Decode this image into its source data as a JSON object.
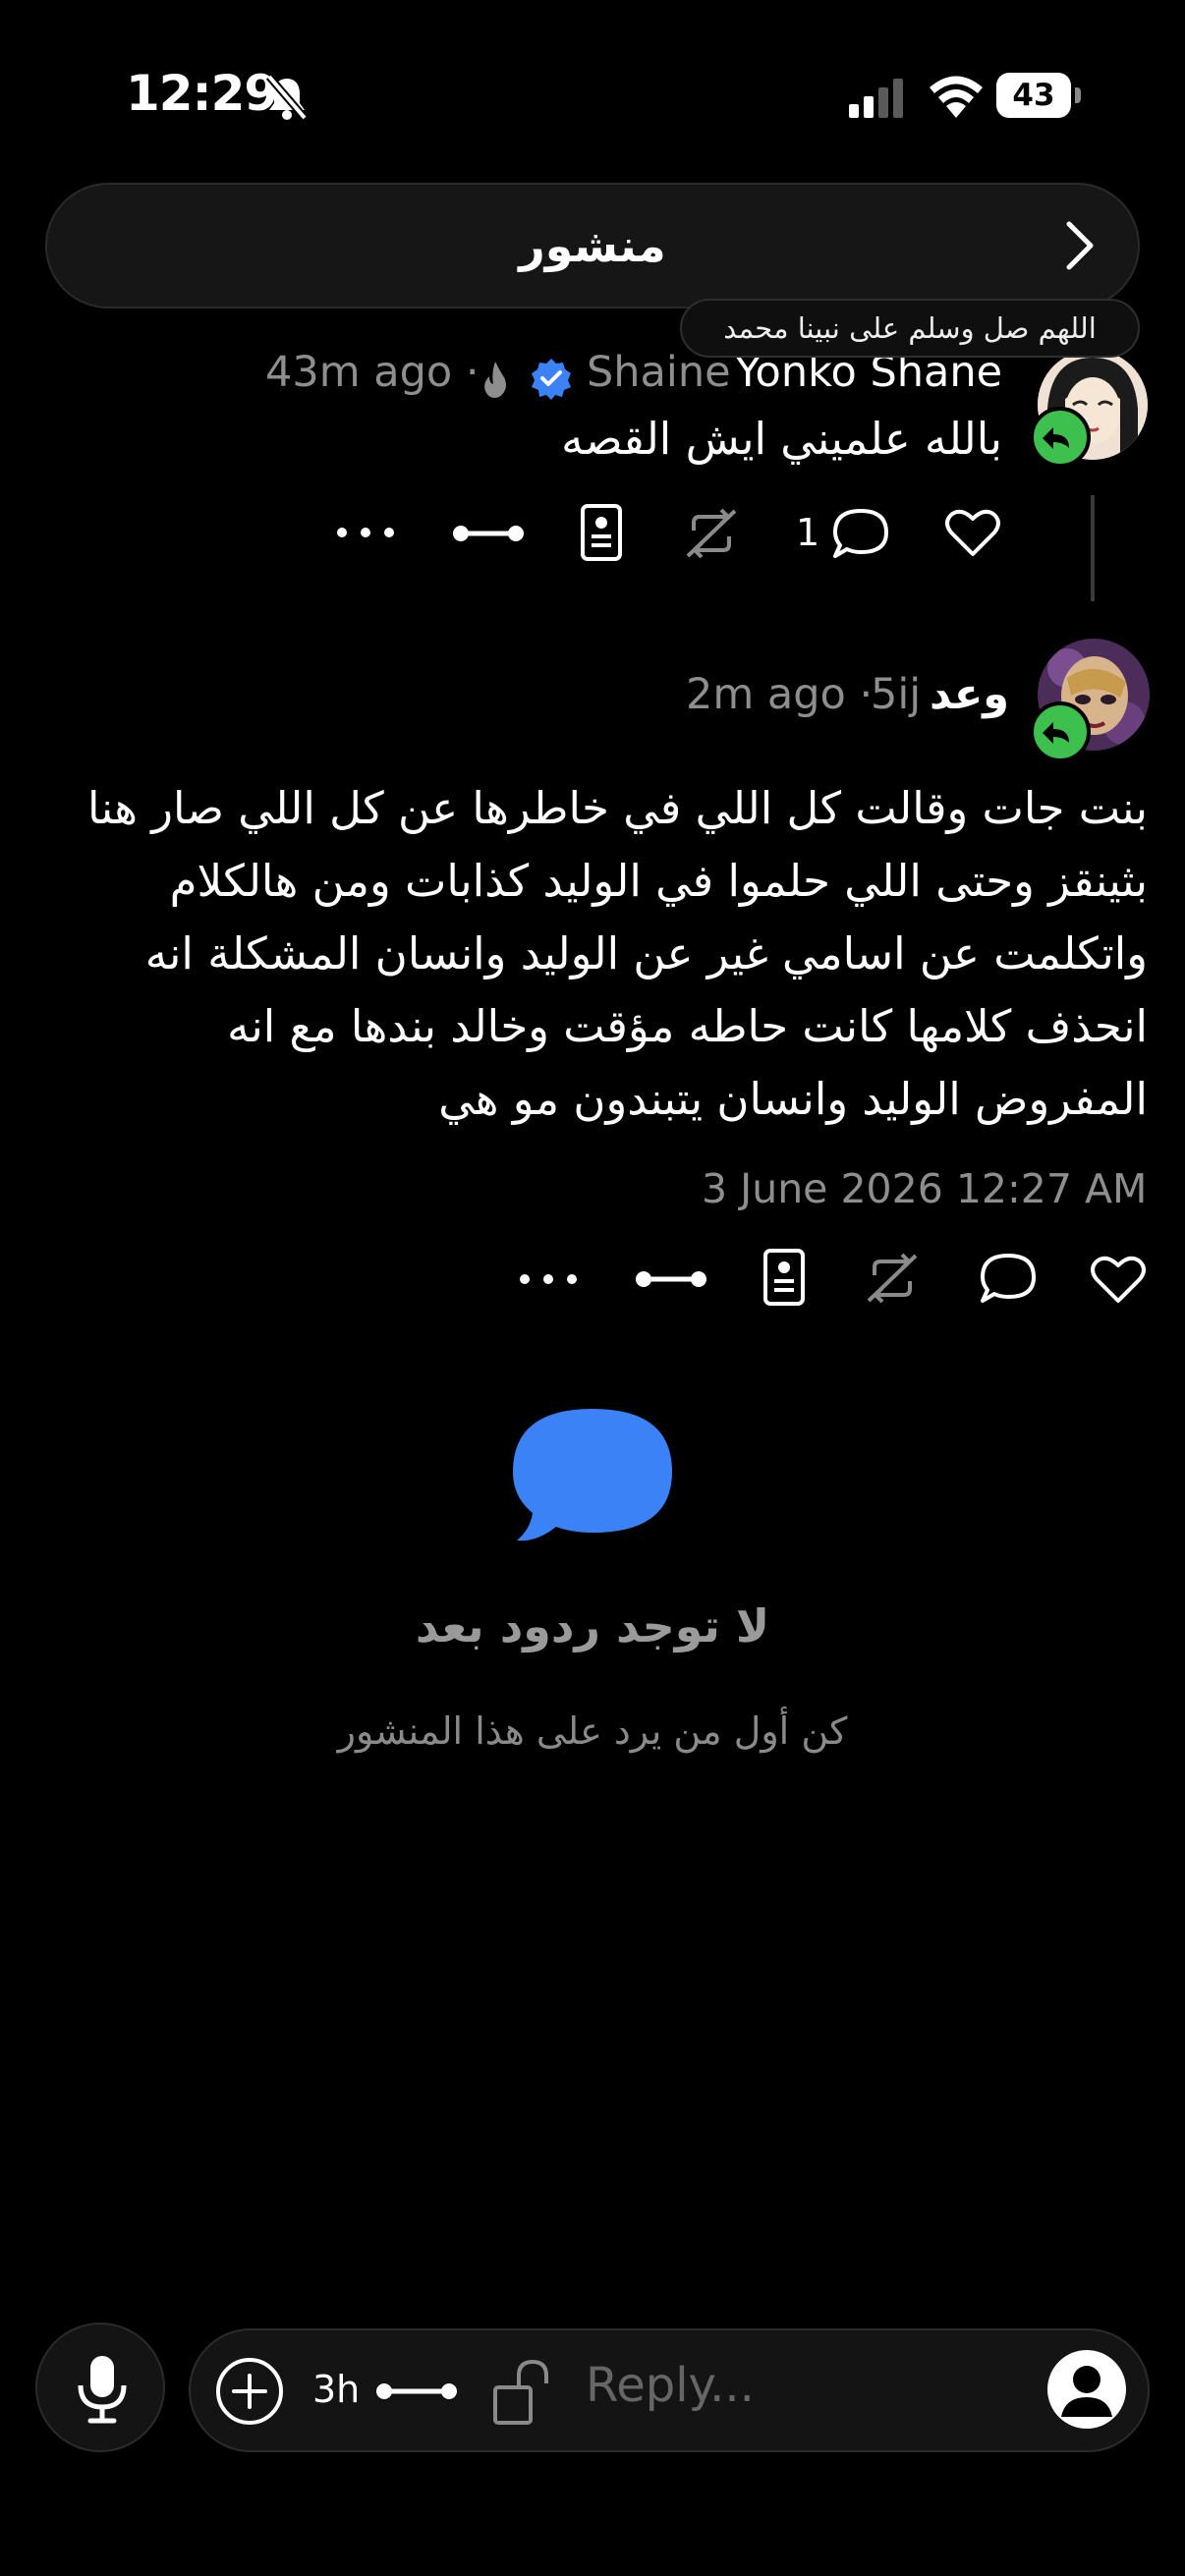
{
  "status_bar": {
    "time": "12:29",
    "battery": "43"
  },
  "header": {
    "title": "منشور"
  },
  "tooltip": {
    "text": "اللهم صل وسلم على نبينا محمد"
  },
  "posts": [
    {
      "display_name": "Yonko Shane",
      "username": "Shaine",
      "verified": true,
      "timestamp": "43m ago",
      "text": "بالله علميني ايش القصه",
      "reply_count": "1"
    },
    {
      "display_name": "وعد",
      "username": "5ij",
      "timestamp": "2m ago",
      "text": "بنت جات وقالت كل اللي في خاطرها عن كل اللي صار هنا بثينقز وحتى اللي حلموا في الوليد كذابات ومن هالكلام واتكلمت عن اسامي غير عن الوليد وانسان المشكلة انه انحذف كلامها كانت حاطه مؤقت وخالد بندها مع انه المفروض الوليد وانسان يتبندون مو هي",
      "full_date": "3 June 2026 12:27 AM"
    }
  ],
  "empty_state": {
    "title": "لا توجد ردود بعد",
    "subtitle": "كن أول من يرد على هذا المنشور"
  },
  "composer": {
    "timer": "3h",
    "placeholder": "Reply..."
  },
  "colors": {
    "accent": "#3b82f6",
    "repost_green": "#3ec04e",
    "background": "#000000",
    "muted": "#8e8e8e"
  }
}
